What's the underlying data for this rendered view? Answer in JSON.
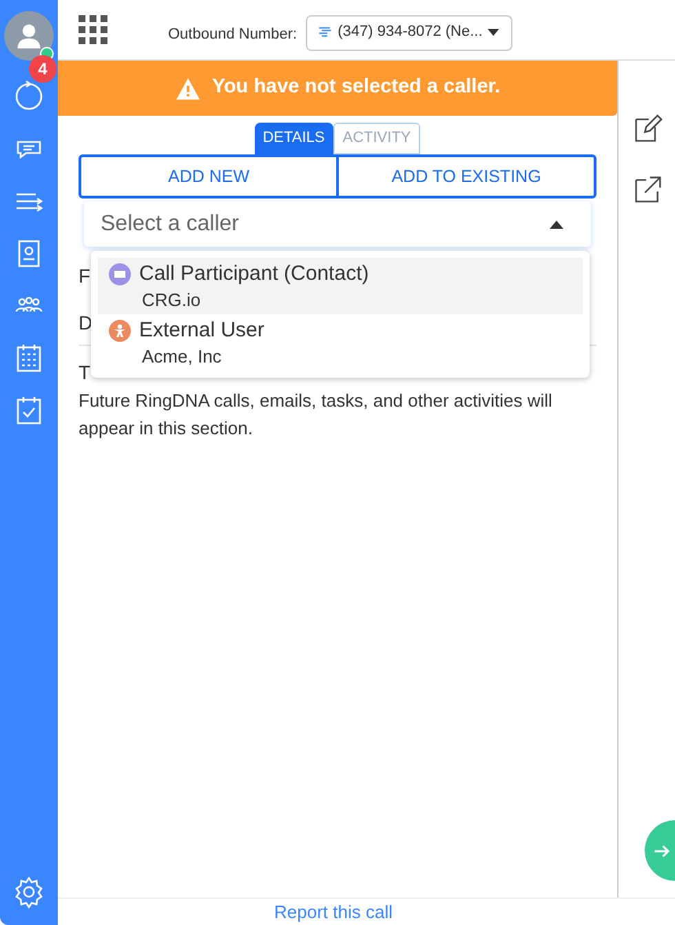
{
  "sidebar": {
    "user_online": true,
    "badge": "4"
  },
  "header": {
    "outbound_label": "Outbound Number:",
    "outbound_number": "(347) 934-8072 (Ne..."
  },
  "alert": {
    "text": "You have not selected a caller."
  },
  "tabs": [
    {
      "label": "DETAILS",
      "selected": true
    },
    {
      "label": "ACTIVITY",
      "selected": false
    }
  ],
  "actions": [
    "ADD NEW",
    "ADD TO EXISTING"
  ],
  "caller_select": {
    "placeholder": "Select a caller",
    "expanded": true,
    "options": [
      {
        "kind": "contact",
        "title": "Call Participant (Contact)",
        "subtitle": "CRG.io",
        "selected": true
      },
      {
        "kind": "external",
        "title": "External User",
        "subtitle": "Acme, Inc",
        "selected": false
      }
    ]
  },
  "behind_dropdown": [
    "F",
    "D",
    "T"
  ],
  "activity_text": "Future RingDNA calls, emails, tasks, and other activities will appear in this section.",
  "footer": {
    "link": "Report this call"
  }
}
